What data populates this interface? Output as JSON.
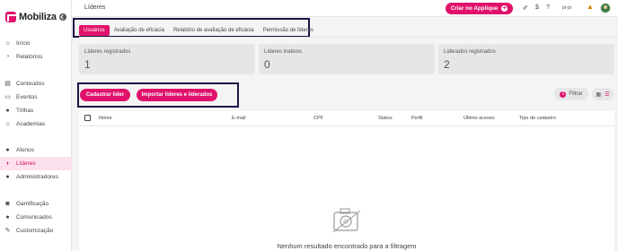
{
  "brand": {
    "name": "Mobiliza",
    "color": "#e0126b"
  },
  "sidebar": {
    "items": [
      {
        "label": "Início",
        "icon": "home-icon",
        "glyph": "⌂",
        "active": false
      },
      {
        "label": "Relatórios",
        "icon": "chart-icon",
        "glyph": "◔",
        "active": false
      },
      {
        "label": "Conteúdos",
        "icon": "document-icon",
        "glyph": "▤",
        "active": false
      },
      {
        "label": "Eventos",
        "icon": "chat-icon",
        "glyph": "▭",
        "active": false
      },
      {
        "label": "Trilhas",
        "icon": "globe-icon",
        "glyph": "●",
        "active": false
      },
      {
        "label": "Academias",
        "icon": "institution-icon",
        "glyph": "⌂",
        "active": false
      },
      {
        "label": "Alunos",
        "icon": "user-icon",
        "glyph": "●",
        "active": false
      },
      {
        "label": "Líderes",
        "icon": "users-icon",
        "glyph": "◗",
        "active": true
      },
      {
        "label": "Administradores",
        "icon": "admin-icon",
        "glyph": "●",
        "active": false
      },
      {
        "label": "Gamificação",
        "icon": "gamepad-icon",
        "glyph": "◙",
        "active": false
      },
      {
        "label": "Comunicados",
        "icon": "message-icon",
        "glyph": "●",
        "active": false
      },
      {
        "label": "Customização",
        "icon": "brush-icon",
        "glyph": "✎",
        "active": false
      }
    ]
  },
  "header": {
    "title": "Líderes",
    "applique_button": "Criar no Applique",
    "language": "pt-pt"
  },
  "tabs": [
    {
      "label": "Usuários",
      "active": true
    },
    {
      "label": "Avaliação de eficácia",
      "active": false
    },
    {
      "label": "Relatório de avaliação de eficácia",
      "active": false
    },
    {
      "label": "Permissão de líderes",
      "active": false
    }
  ],
  "stats": [
    {
      "label": "Líderes registrados",
      "value": "1"
    },
    {
      "label": "Líderes inativos",
      "value": "0"
    },
    {
      "label": "Liderados registrados",
      "value": "2"
    }
  ],
  "actions": {
    "create_leader": "Cadastrar líder",
    "import_leaders": "Importar líderes e liderados",
    "filter": "Filtrar",
    "filter_count": "1"
  },
  "table": {
    "columns": [
      "Nome",
      "E-mail",
      "CPF",
      "Status",
      "Perfil",
      "Último acesso",
      "Tipo de cadastro"
    ],
    "empty_message": "Nenhum resultado encontrado para a filtragem"
  }
}
